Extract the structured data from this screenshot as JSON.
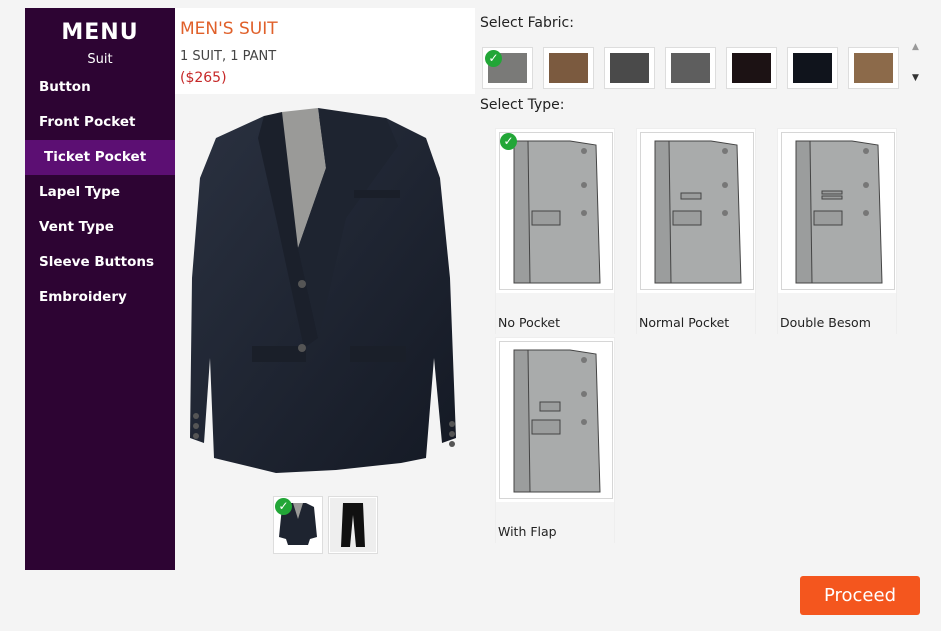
{
  "menu": {
    "title": "MENU",
    "subtitle": "Suit",
    "items": [
      {
        "label": "Button"
      },
      {
        "label": "Front Pocket"
      },
      {
        "label": "Ticket Pocket",
        "active": true
      },
      {
        "label": "Lapel Type"
      },
      {
        "label": "Vent Type"
      },
      {
        "label": "Sleeve Buttons"
      },
      {
        "label": "Embroidery"
      }
    ]
  },
  "product": {
    "name": "MEN'S SUIT",
    "description": "1 SUIT, 1 PANT",
    "price": "($265)"
  },
  "views": {
    "selected": "jacket",
    "items": [
      "jacket-view",
      "pant-view"
    ]
  },
  "fabric": {
    "label": "Select Fabric:",
    "selected_index": 0,
    "swatches": [
      {
        "color": "#7a7a78"
      },
      {
        "color": "#7b5a3f"
      },
      {
        "color": "#4a4a4a"
      },
      {
        "color": "#5e5e5e"
      },
      {
        "color": "#1c1214"
      },
      {
        "color": "#10141c"
      },
      {
        "color": "#8c6a4a"
      }
    ]
  },
  "pocket_type": {
    "label": "Select Type:",
    "selected_index": 0,
    "options": [
      {
        "name": "No Pocket"
      },
      {
        "name": "Normal Pocket"
      },
      {
        "name": "Double Besom"
      },
      {
        "name": "With Flap"
      }
    ]
  },
  "actions": {
    "proceed_label": "Proceed"
  },
  "colors": {
    "sidebar_bg": "#2d0433",
    "sidebar_active": "#5c0f73",
    "accent": "#f4561e",
    "price": "#c62828",
    "check": "#22a637"
  }
}
